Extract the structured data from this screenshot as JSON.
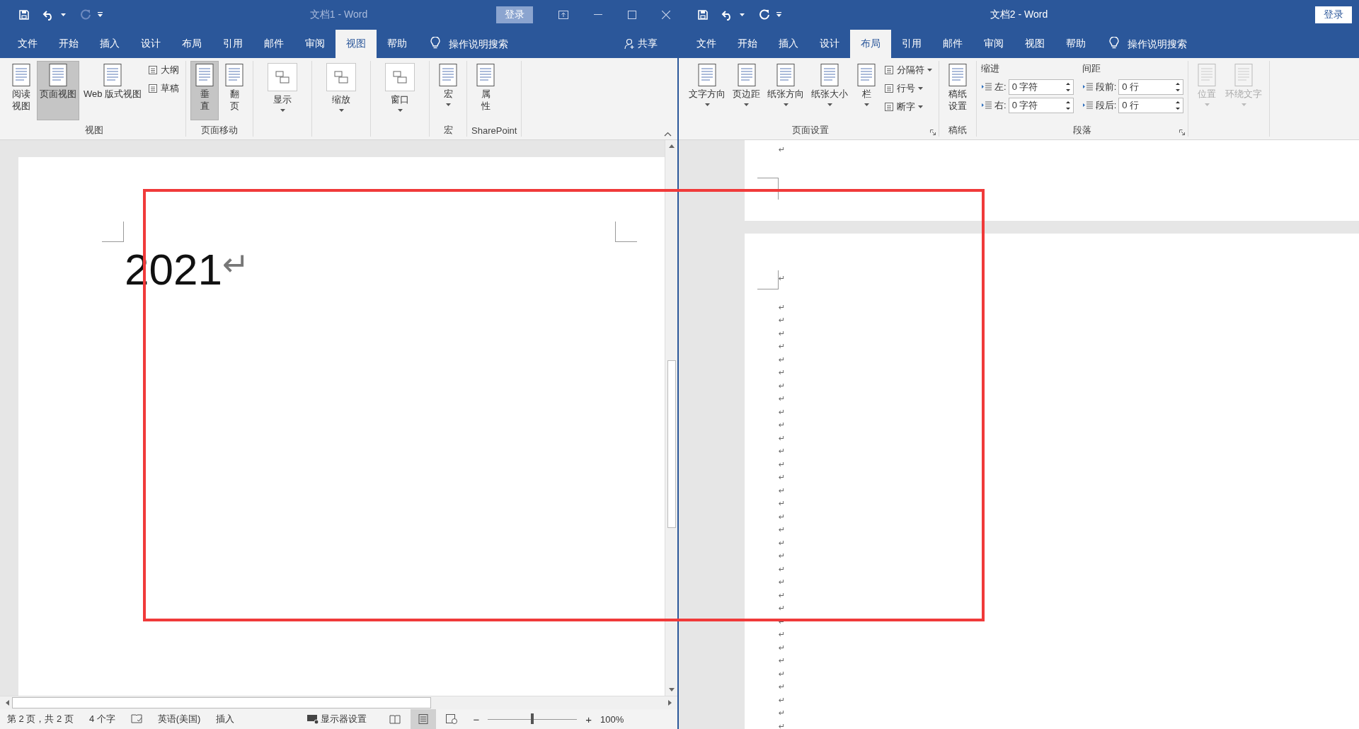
{
  "windows": [
    {
      "title": "文档1 - Word",
      "active": false,
      "redo_enabled": false,
      "sign_in": "登录",
      "window_controls": true,
      "share": "共享",
      "search": "操作说明搜索",
      "tabs": [
        {
          "label": "文件",
          "selected": false
        },
        {
          "label": "开始",
          "selected": false
        },
        {
          "label": "插入",
          "selected": false
        },
        {
          "label": "设计",
          "selected": false
        },
        {
          "label": "布局",
          "selected": false
        },
        {
          "label": "引用",
          "selected": false
        },
        {
          "label": "邮件",
          "selected": false
        },
        {
          "label": "审阅",
          "selected": false
        },
        {
          "label": "视图",
          "selected": true
        },
        {
          "label": "帮助",
          "selected": false
        }
      ],
      "groups": [
        {
          "kind": "buttons",
          "label": "视图",
          "launcher": false,
          "items": [
            {
              "kind": "large",
              "lines": [
                "阅读",
                "视图"
              ],
              "selected": false,
              "disabled": false,
              "dropdown": false
            },
            {
              "kind": "large",
              "lines": [
                "页面视图"
              ],
              "selected": true,
              "disabled": false,
              "dropdown": false
            },
            {
              "kind": "large",
              "lines": [
                "Web 版式视图"
              ],
              "selected": false,
              "disabled": false,
              "dropdown": false
            },
            {
              "kind": "small",
              "label": "大纲",
              "selected": false,
              "disabled": false,
              "dropdown": false
            },
            {
              "kind": "small",
              "label": "草稿",
              "selected": false,
              "disabled": false,
              "dropdown": false
            }
          ]
        },
        {
          "kind": "buttons",
          "label": "页面移动",
          "launcher": false,
          "items": [
            {
              "kind": "large",
              "lines": [
                "垂",
                "直"
              ],
              "selected": true,
              "disabled": false,
              "dropdown": false
            },
            {
              "kind": "large",
              "lines": [
                "翻",
                "页"
              ],
              "selected": false,
              "disabled": false,
              "dropdown": false
            }
          ]
        },
        {
          "kind": "buttons",
          "launcher": false,
          "items": [
            {
              "kind": "boxed",
              "lines": [
                "显示"
              ],
              "selected": false,
              "disabled": false,
              "dropdown": true
            }
          ]
        },
        {
          "kind": "buttons",
          "launcher": false,
          "items": [
            {
              "kind": "boxed",
              "lines": [
                "缩放"
              ],
              "selected": false,
              "disabled": false,
              "dropdown": true
            }
          ]
        },
        {
          "kind": "buttons",
          "launcher": false,
          "items": [
            {
              "kind": "boxed",
              "lines": [
                "窗口"
              ],
              "selected": false,
              "disabled": false,
              "dropdown": true
            }
          ]
        },
        {
          "kind": "buttons",
          "label": "宏",
          "launcher": false,
          "items": [
            {
              "kind": "large",
              "lines": [
                "宏"
              ],
              "selected": false,
              "disabled": false,
              "dropdown": true
            }
          ]
        },
        {
          "kind": "buttons",
          "label": "SharePoint",
          "launcher": false,
          "items": [
            {
              "kind": "large",
              "lines": [
                "属",
                "性"
              ],
              "selected": false,
              "disabled": false,
              "dropdown": false
            }
          ]
        }
      ],
      "document": {
        "kind": "text",
        "text": "2021",
        "mark": "↵"
      },
      "status_bar": {
        "page": "第 2 页，共 2 页",
        "words": "4 个字",
        "language": "英语(美国)",
        "mode": "插入",
        "display": "显示器设置",
        "views": [
          {
            "kind": "read",
            "selected": false
          },
          {
            "kind": "print",
            "selected": true
          },
          {
            "kind": "web",
            "selected": false
          }
        ],
        "zoom_out": "−",
        "zoom_in": "+",
        "zoom": {
          "level": 0.5
        },
        "percent": "100%"
      }
    },
    {
      "title": "文档2 - Word",
      "active": true,
      "redo_enabled": true,
      "sign_in": "登录",
      "window_controls": false,
      "search": "操作说明搜索",
      "tabs": [
        {
          "label": "文件",
          "selected": false
        },
        {
          "label": "开始",
          "selected": false
        },
        {
          "label": "插入",
          "selected": false
        },
        {
          "label": "设计",
          "selected": false
        },
        {
          "label": "布局",
          "selected": true
        },
        {
          "label": "引用",
          "selected": false
        },
        {
          "label": "邮件",
          "selected": false
        },
        {
          "label": "审阅",
          "selected": false
        },
        {
          "label": "视图",
          "selected": false
        },
        {
          "label": "帮助",
          "selected": false
        }
      ],
      "groups": [
        {
          "kind": "buttons",
          "label": "页面设置",
          "launcher": true,
          "items": [
            {
              "kind": "large",
              "lines": [
                "文字方向"
              ],
              "selected": false,
              "disabled": false,
              "dropdown": true
            },
            {
              "kind": "large",
              "lines": [
                "页边距"
              ],
              "selected": false,
              "disabled": false,
              "dropdown": true
            },
            {
              "kind": "large",
              "lines": [
                "纸张方向"
              ],
              "selected": false,
              "disabled": false,
              "dropdown": true
            },
            {
              "kind": "large",
              "lines": [
                "纸张大小"
              ],
              "selected": false,
              "disabled": false,
              "dropdown": true
            },
            {
              "kind": "large",
              "lines": [
                "栏"
              ],
              "selected": false,
              "disabled": false,
              "dropdown": true
            },
            {
              "kind": "small",
              "label": "分隔符",
              "selected": false,
              "disabled": false,
              "dropdown": true
            },
            {
              "kind": "small",
              "label": "行号",
              "selected": false,
              "disabled": false,
              "dropdown": true
            },
            {
              "kind": "small",
              "label": "断字",
              "selected": false,
              "disabled": false,
              "dropdown": true
            }
          ]
        },
        {
          "kind": "buttons",
          "label": "稿纸",
          "launcher": false,
          "items": [
            {
              "kind": "large",
              "lines": [
                "稿纸",
                "设置"
              ],
              "selected": false,
              "disabled": false,
              "dropdown": false
            }
          ]
        },
        {
          "kind": "fields",
          "label": "段落",
          "launcher": true,
          "columns": [
            {
              "heading": "缩进",
              "fields": [
                {
                  "label": "左:",
                  "value": "0 字符"
                },
                {
                  "label": "右:",
                  "value": "0 字符"
                }
              ]
            },
            {
              "heading": "间距",
              "fields": [
                {
                  "label": "段前:",
                  "value": "0 行"
                },
                {
                  "label": "段后:",
                  "value": "0 行"
                }
              ]
            }
          ]
        },
        {
          "kind": "buttons",
          "launcher": false,
          "items": [
            {
              "kind": "large",
              "lines": [
                "位置"
              ],
              "selected": false,
              "disabled": true,
              "dropdown": true
            },
            {
              "kind": "large",
              "lines": [
                "环绕文字"
              ],
              "selected": false,
              "disabled": true,
              "dropdown": true
            }
          ]
        }
      ],
      "document": {
        "kind": "marks",
        "pages": [
          {
            "marks": [
              "↵"
            ]
          },
          {
            "marks": [
              "↵",
              "↵",
              "↵",
              "↵",
              "↵",
              "↵",
              "↵",
              "↵",
              "↵",
              "↵",
              "↵",
              "↵",
              "↵",
              "↵",
              "↵",
              "↵",
              "↵",
              "↵",
              "↵",
              "↵",
              "↵",
              "↵",
              "↵",
              "↵",
              "↵",
              "↵",
              "↵",
              "↵",
              "↵",
              "↵",
              "↵",
              "↵",
              "↵",
              "↵"
            ]
          }
        ]
      }
    }
  ]
}
